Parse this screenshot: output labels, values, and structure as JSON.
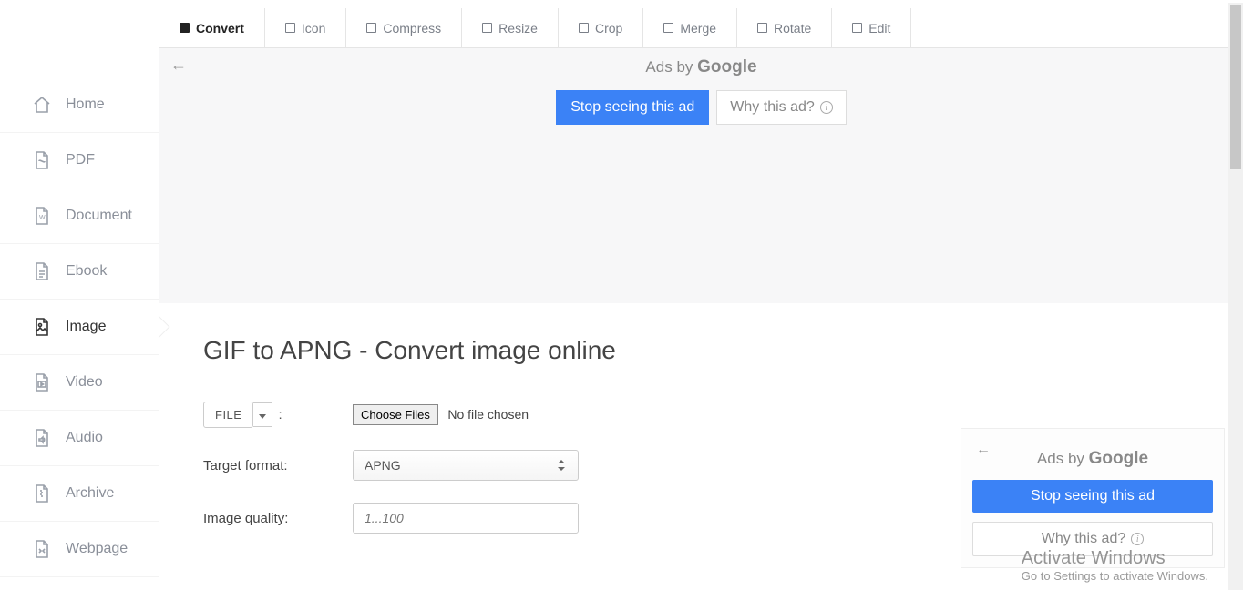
{
  "sidebar": {
    "items": [
      {
        "label": "Home",
        "icon": "home-icon"
      },
      {
        "label": "PDF",
        "icon": "pdf-icon"
      },
      {
        "label": "Document",
        "icon": "document-icon"
      },
      {
        "label": "Ebook",
        "icon": "ebook-icon"
      },
      {
        "label": "Image",
        "icon": "image-icon"
      },
      {
        "label": "Video",
        "icon": "video-icon"
      },
      {
        "label": "Audio",
        "icon": "audio-icon"
      },
      {
        "label": "Archive",
        "icon": "archive-icon"
      },
      {
        "label": "Webpage",
        "icon": "webpage-icon"
      }
    ]
  },
  "tabs": [
    {
      "label": "Convert"
    },
    {
      "label": "Icon"
    },
    {
      "label": "Compress"
    },
    {
      "label": "Resize"
    },
    {
      "label": "Crop"
    },
    {
      "label": "Merge"
    },
    {
      "label": "Rotate"
    },
    {
      "label": "Edit"
    }
  ],
  "ads": {
    "by_label": "Ads by ",
    "google": "Google",
    "stop": "Stop seeing this ad",
    "why": "Why this ad?"
  },
  "page": {
    "title": "GIF to APNG - Convert image online",
    "file_btn": "FILE",
    "choose": "Choose Files",
    "nofile": "No file chosen",
    "target_label": "Target format:",
    "target_value": "APNG",
    "quality_label": "Image quality:",
    "quality_placeholder": "1...100"
  },
  "watermark": {
    "line1": "Activate Windows",
    "line2": "Go to Settings to activate Windows."
  }
}
